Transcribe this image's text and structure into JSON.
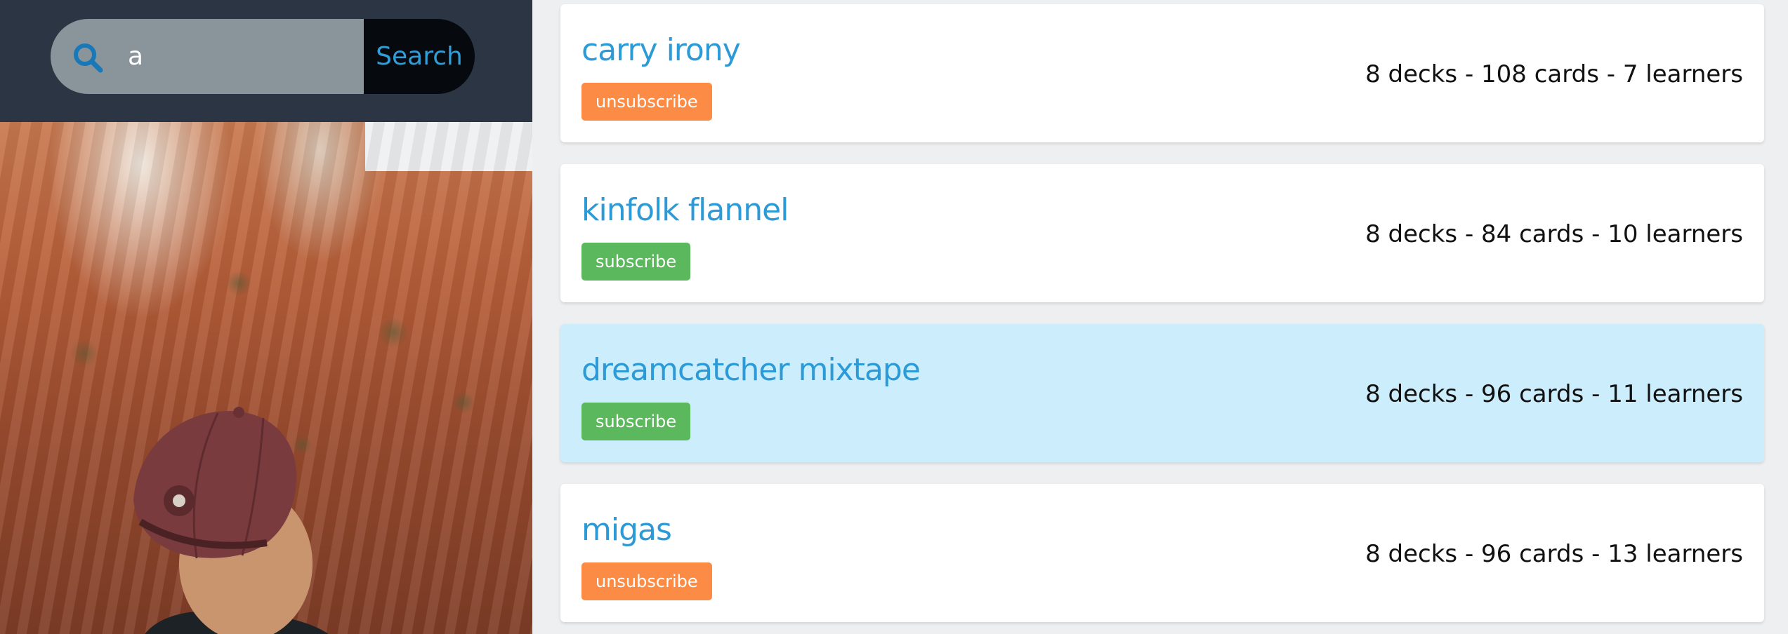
{
  "search": {
    "value": "a",
    "button_label": "Search",
    "icon": "search-icon",
    "accent_color": "#2f9ed9"
  },
  "hero_image": {
    "description_icon": "photo"
  },
  "decks": [
    {
      "title": "carry irony",
      "button_label": "unsubscribe",
      "button_type": "unsubscribe",
      "stats": "8 decks - 108 cards - 7 learners",
      "highlighted": false
    },
    {
      "title": "kinfolk flannel",
      "button_label": "subscribe",
      "button_type": "subscribe",
      "stats": "8 decks - 84 cards - 10 learners",
      "highlighted": false
    },
    {
      "title": "dreamcatcher mixtape",
      "button_label": "subscribe",
      "button_type": "subscribe",
      "stats": "8 decks - 96 cards - 11 learners",
      "highlighted": true
    },
    {
      "title": "migas",
      "button_label": "unsubscribe",
      "button_type": "unsubscribe",
      "stats": "8 decks - 96 cards - 13 learners",
      "highlighted": false
    }
  ],
  "colors": {
    "header_bg": "#2b3544",
    "title": "#2b9ad6",
    "unsubscribe": "#fc8c45",
    "subscribe": "#5cb85c",
    "highlight_bg": "#cceefc"
  }
}
